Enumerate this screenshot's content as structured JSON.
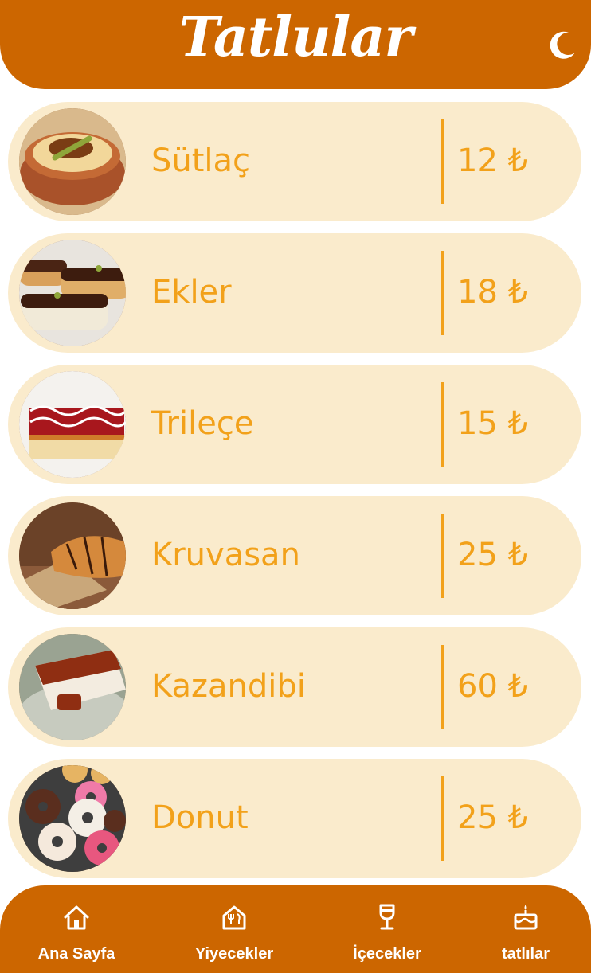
{
  "header": {
    "title": "Tatlular"
  },
  "items": [
    {
      "name": "Sütlaç",
      "price": "12 ₺"
    },
    {
      "name": "Ekler",
      "price": "18 ₺"
    },
    {
      "name": "Trileçe",
      "price": "15 ₺"
    },
    {
      "name": "Kruvasan",
      "price": "25 ₺"
    },
    {
      "name": "Kazandibi",
      "price": "60 ₺"
    },
    {
      "name": "Donut",
      "price": "25 ₺"
    }
  ],
  "nav": [
    {
      "label": "Ana Sayfa",
      "icon": "home-icon"
    },
    {
      "label": "Yiyecekler",
      "icon": "restaurant-icon"
    },
    {
      "label": "İçecekler",
      "icon": "wine-glass-icon"
    },
    {
      "label": "tatlılar",
      "icon": "cake-icon"
    }
  ],
  "colors": {
    "primary": "#cc6600",
    "card": "#faebcc",
    "accent": "#f2a11a",
    "text_light": "#ffffff"
  },
  "icons": {
    "theme_toggle": "moon-icon"
  }
}
